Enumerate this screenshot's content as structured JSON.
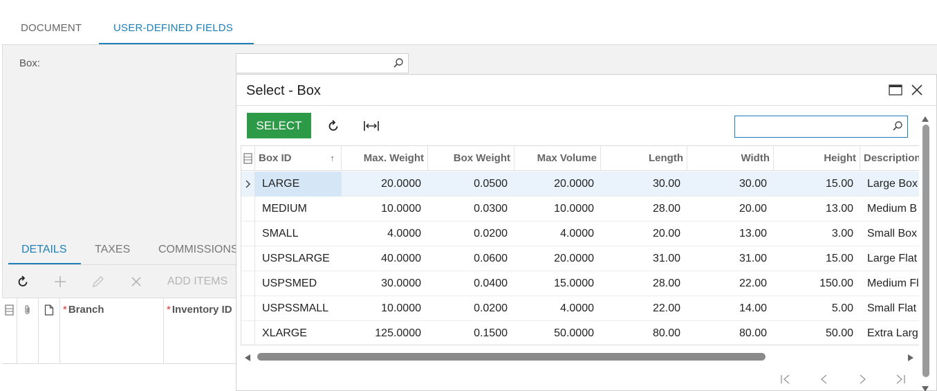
{
  "top_tabs": {
    "document": "DOCUMENT",
    "user_defined_fields": "USER-DEFINED FIELDS"
  },
  "form": {
    "box_label": "Box:",
    "box_value": ""
  },
  "sub_tabs": {
    "details": "DETAILS",
    "taxes": "TAXES",
    "commissions": "COMMISSIONS"
  },
  "toolbar": {
    "add_items": "ADD ITEMS"
  },
  "grid": {
    "branch": "Branch",
    "inventory_id": "Inventory ID",
    "required_mark": "*"
  },
  "dialog": {
    "title": "Select - Box",
    "select_button": "SELECT",
    "search_value": "",
    "columns": [
      "Box ID",
      "Max. Weight",
      "Box Weight",
      "Max Volume",
      "Length",
      "Width",
      "Height",
      "Description"
    ],
    "rows": [
      [
        "LARGE",
        "20.0000",
        "0.0500",
        "20.0000",
        "30.00",
        "30.00",
        "15.00",
        "Large Box"
      ],
      [
        "MEDIUM",
        "10.0000",
        "0.0300",
        "10.0000",
        "28.00",
        "20.00",
        "13.00",
        "Medium B"
      ],
      [
        "SMALL",
        "4.0000",
        "0.0200",
        "4.0000",
        "20.00",
        "13.00",
        "3.00",
        "Small Box"
      ],
      [
        "USPSLARGE",
        "40.0000",
        "0.0600",
        "20.0000",
        "31.00",
        "31.00",
        "15.00",
        "Large Flat"
      ],
      [
        "USPSMED",
        "30.0000",
        "0.0400",
        "15.0000",
        "28.00",
        "22.00",
        "150.00",
        "Medium Fl"
      ],
      [
        "USPSSMALL",
        "10.0000",
        "0.0200",
        "4.0000",
        "22.00",
        "14.00",
        "5.00",
        "Small Flat"
      ],
      [
        "XLARGE",
        "125.0000",
        "0.1500",
        "50.0000",
        "80.00",
        "80.00",
        "50.00",
        "Extra Larg"
      ]
    ]
  },
  "colors": {
    "accent": "#1f7fb8",
    "select_button": "#2c9a47",
    "required": "#d8302f"
  }
}
